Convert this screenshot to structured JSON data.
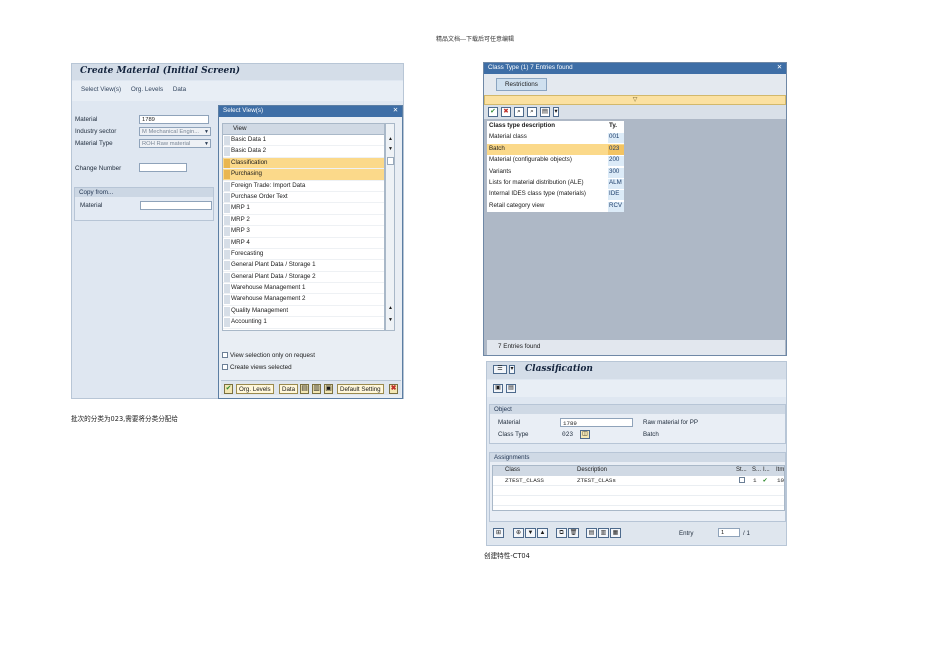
{
  "header_note": "精品文档---下载后可任意编辑",
  "create_material": {
    "title": "Create Material (Initial Screen)",
    "menu": [
      "Select View(s)",
      "Org. Levels",
      "Data"
    ],
    "material_label": "Material",
    "material_value": "1789",
    "industry_label": "Industry sector",
    "industry_value": "M Mechanical Engin...",
    "type_label": "Material Type",
    "type_value": "ROH Raw material",
    "change_label": "Change Number",
    "copy_from_label": "Copy from...",
    "copy_material_label": "Material"
  },
  "select_views": {
    "title": "Select View(s)",
    "column": "View",
    "items": [
      {
        "label": "Basic Data 1",
        "selected": false
      },
      {
        "label": "Basic Data 2",
        "selected": false
      },
      {
        "label": "Classification",
        "selected": true
      },
      {
        "label": "Purchasing",
        "selected": true
      },
      {
        "label": "Foreign Trade: Import Data",
        "selected": false
      },
      {
        "label": "Purchase Order Text",
        "selected": false
      },
      {
        "label": "MRP 1",
        "selected": false
      },
      {
        "label": "MRP 2",
        "selected": false
      },
      {
        "label": "MRP 3",
        "selected": false
      },
      {
        "label": "MRP 4",
        "selected": false
      },
      {
        "label": "Forecasting",
        "selected": false
      },
      {
        "label": "General Plant Data / Storage 1",
        "selected": false
      },
      {
        "label": "General Plant Data / Storage 2",
        "selected": false
      },
      {
        "label": "Warehouse Management 1",
        "selected": false
      },
      {
        "label": "Warehouse Management 2",
        "selected": false
      },
      {
        "label": "Quality Management",
        "selected": false
      },
      {
        "label": "Accounting 1",
        "selected": false
      }
    ],
    "check_request": "View selection only on request",
    "check_create": "Create views selected",
    "btn_org": "Org. Levels",
    "btn_data": "Data",
    "btn_default": "Default Setting"
  },
  "caption_left": "批次的分类为023,需要将分类分配给",
  "class_type": {
    "title": "Class Type (1)   7 Entries found",
    "tab": "Restrictions",
    "col_desc": "Class type description",
    "col_ty": "Ty.",
    "rows": [
      {
        "desc": "Material class",
        "ty": "001",
        "hl": false
      },
      {
        "desc": "Batch",
        "ty": "023",
        "hl": true
      },
      {
        "desc": "Material (configurable objects)",
        "ty": "200",
        "hl": false
      },
      {
        "desc": "Variants",
        "ty": "300",
        "hl": false
      },
      {
        "desc": "Lists for material distribution (ALE)",
        "ty": "ALM",
        "hl": false
      },
      {
        "desc": "Internal IDES class type (materials)",
        "ty": "IDE",
        "hl": false
      },
      {
        "desc": "Retail category view",
        "ty": "RCV",
        "hl": false
      }
    ],
    "footer": "7 Entries found"
  },
  "classification": {
    "title": "Classification",
    "object_label": "Object",
    "material_label": "Material",
    "material_value": "1789",
    "material_desc": "Raw material  for PP",
    "classtype_label": "Class Type",
    "classtype_value": "023",
    "classtype_desc": "Batch",
    "assignments_label": "Assignments",
    "col_class": "Class",
    "col_desc": "Description",
    "col_st": "St...",
    "col_s": "S...",
    "col_i": "I...",
    "col_itm": "Itm",
    "row_class": "ZTEST_CLASS",
    "row_desc": "ZTEST_CLASs",
    "row_s": "1",
    "row_itm": "10",
    "entry_label": "Entry",
    "entry_value": "1",
    "entry_total": "/ 1"
  },
  "caption_right": "创建特性-CT04"
}
